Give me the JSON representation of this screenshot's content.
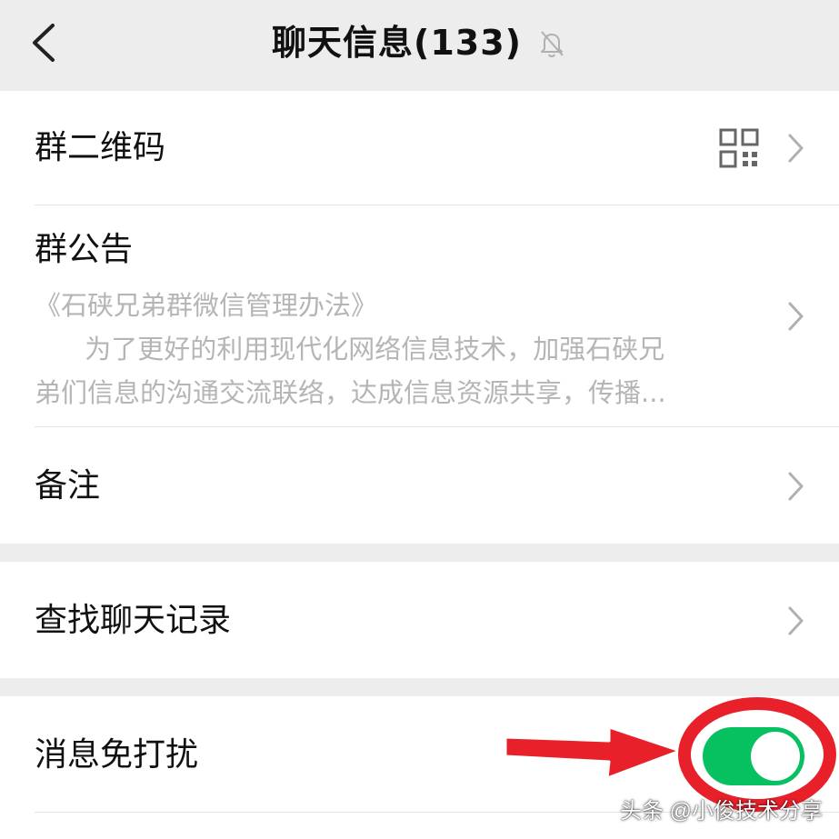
{
  "header": {
    "title": "聊天信息(133)",
    "back_icon": "chevron-left-icon",
    "mute_icon": "bell-off-icon"
  },
  "items": {
    "qr_code": {
      "label": "群二维码",
      "icon": "qr-code-icon"
    },
    "notice": {
      "label": "群公告",
      "line1": "《石硖兄弟群微信管理办法》",
      "line2": "      为了更好的利用现代化网络信息技术，加强石硖兄",
      "line3": "弟们信息的沟通交流联络，达成信息资源共享，传播..."
    },
    "remark": {
      "label": "备注"
    },
    "search_history": {
      "label": "查找聊天记录"
    },
    "do_not_disturb": {
      "label": "消息免打扰",
      "enabled": true
    }
  },
  "annotation": {
    "color": "#e8202a",
    "arrow_icon": "red-arrow-annotation",
    "circle_icon": "red-circle-annotation"
  },
  "watermark": "头条 @小俊技术分享",
  "colors": {
    "toggle_on": "#07c160",
    "page_bg": "#ededed",
    "secondary_text": "#b5b5b5"
  }
}
